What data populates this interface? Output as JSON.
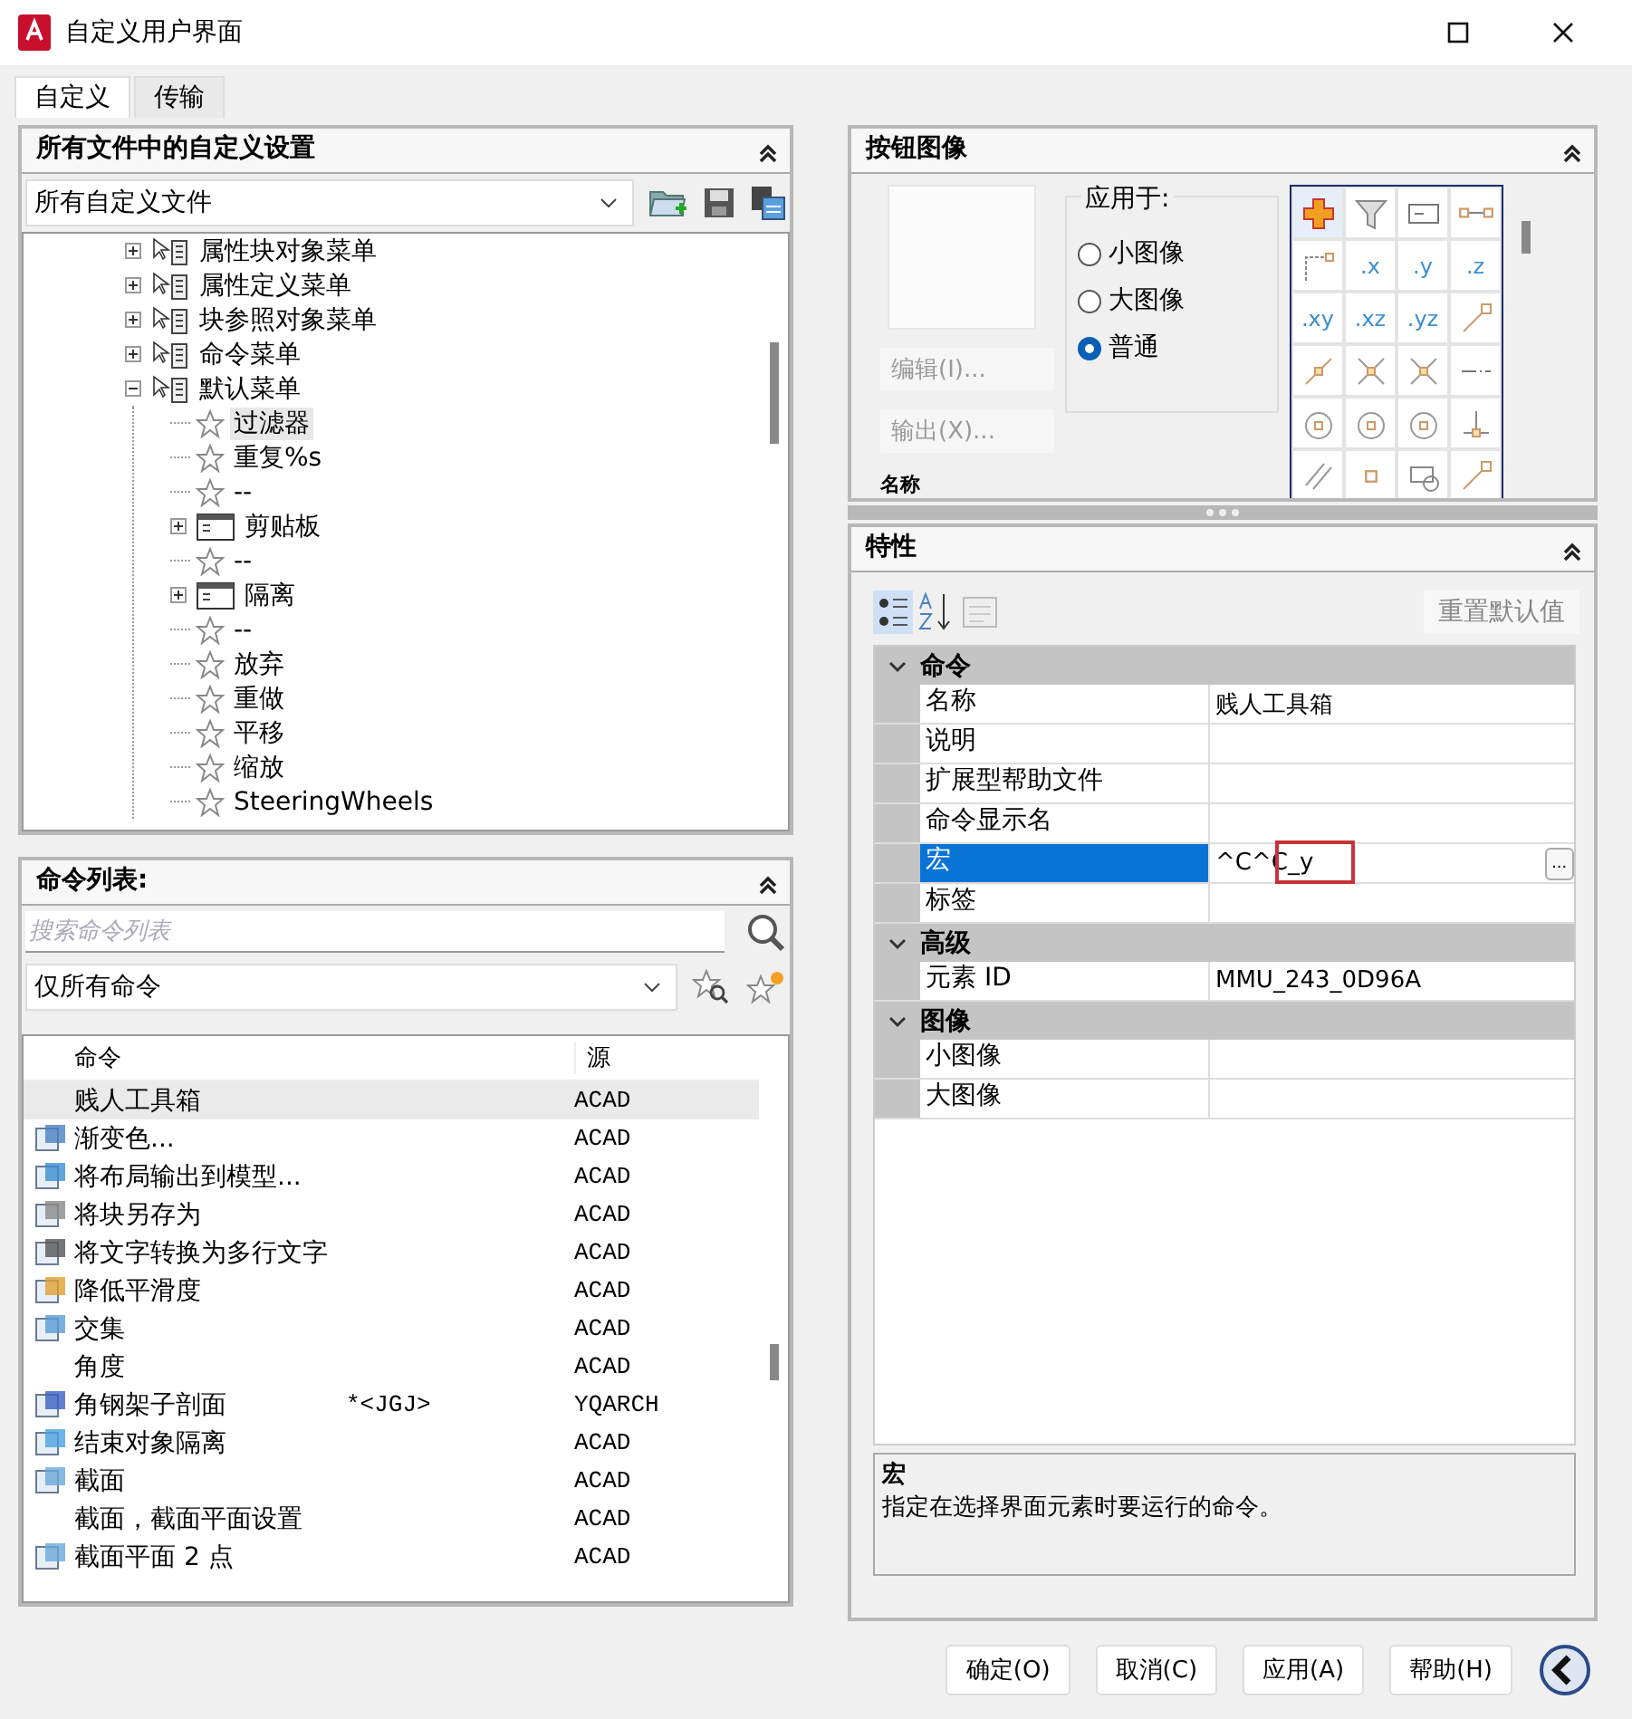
{
  "window": {
    "title": "自定义用户界面"
  },
  "tabs": [
    {
      "label": "自定义",
      "selected": true
    },
    {
      "label": "传输",
      "selected": false
    }
  ],
  "customizations": {
    "title": "所有文件中的自定义设置",
    "filter": "所有自定义文件",
    "tree": [
      {
        "label": "属性块对象菜单",
        "kind": "menu",
        "expanded": false,
        "selected": false
      },
      {
        "label": "属性定义菜单",
        "kind": "menu",
        "expanded": false,
        "selected": false
      },
      {
        "label": "块参照对象菜单",
        "kind": "menu",
        "expanded": false,
        "selected": false
      },
      {
        "label": "命令菜单",
        "kind": "menu",
        "expanded": false,
        "selected": false
      },
      {
        "label": "默认菜单",
        "kind": "menu",
        "expanded": true,
        "selected": false,
        "children": [
          {
            "label": "过滤器",
            "kind": "command",
            "selected": true
          },
          {
            "label": "重复%s",
            "kind": "command",
            "selected": false
          },
          {
            "label": "--",
            "kind": "command",
            "selected": false
          },
          {
            "label": "剪贴板",
            "kind": "submenu",
            "expanded": false,
            "selected": false
          },
          {
            "label": "--",
            "kind": "command",
            "selected": false
          },
          {
            "label": "隔离",
            "kind": "submenu",
            "expanded": false,
            "selected": false
          },
          {
            "label": "--",
            "kind": "command",
            "selected": false
          },
          {
            "label": "放弃",
            "kind": "command",
            "selected": false
          },
          {
            "label": "重做",
            "kind": "command",
            "selected": false
          },
          {
            "label": "平移",
            "kind": "command",
            "selected": false
          },
          {
            "label": "缩放",
            "kind": "command",
            "selected": false
          },
          {
            "label": "SteeringWheels",
            "kind": "command",
            "selected": false
          }
        ]
      }
    ]
  },
  "command_list": {
    "title": "命令列表:",
    "search": {
      "placeholder": "搜索命令列表"
    },
    "filter": "仅所有命令",
    "columns": [
      "命令",
      "源"
    ],
    "rows": [
      {
        "command": "贱人工具箱",
        "source": "ACAD",
        "icon": false,
        "selected": true
      },
      {
        "command": "渐变色...",
        "source": "ACAD",
        "icon": true,
        "selected": false
      },
      {
        "command": "将布局输出到模型...",
        "source": "ACAD",
        "icon": true,
        "selected": false
      },
      {
        "command": "将块另存为",
        "source": "ACAD",
        "icon": true,
        "selected": false
      },
      {
        "command": "将文字转换为多行文字",
        "source": "ACAD",
        "icon": true,
        "selected": false
      },
      {
        "command": "降低平滑度",
        "source": "ACAD",
        "icon": true,
        "selected": false
      },
      {
        "command": "交集",
        "source": "ACAD",
        "icon": true,
        "selected": false
      },
      {
        "command": "角度",
        "source": "ACAD",
        "icon": false,
        "selected": false
      },
      {
        "command": "角钢架子剖面",
        "alias": "*<JGJ>",
        "source": "YQARCH",
        "icon": true,
        "selected": false
      },
      {
        "command": "结束对象隔离",
        "source": "ACAD",
        "icon": true,
        "selected": false
      },
      {
        "command": "截面",
        "source": "ACAD",
        "icon": true,
        "selected": false
      },
      {
        "command": "截面，截面平面设置",
        "source": "ACAD",
        "icon": false,
        "selected": false
      },
      {
        "command": "截面平面 2 点",
        "source": "ACAD",
        "icon": true,
        "selected": false
      }
    ]
  },
  "button_image": {
    "title": "按钮图像",
    "buttons": [
      {
        "label": "编辑(I)...",
        "disabled": true
      },
      {
        "label": "输出(X)...",
        "disabled": true
      }
    ],
    "apply_to": {
      "legend": "应用于:",
      "options": [
        {
          "label": "小图像",
          "selected": false
        },
        {
          "label": "大图像",
          "selected": false
        },
        {
          "label": "普通",
          "selected": true
        }
      ]
    },
    "images": [
      {
        "kind": "icon",
        "selected": true
      },
      {
        "kind": "icon",
        "selected": false
      },
      {
        "kind": "icon",
        "selected": false
      },
      {
        "kind": "icon",
        "selected": false
      },
      {
        "kind": "icon",
        "selected": false
      },
      {
        "kind": "label",
        "text": ".x",
        "selected": false
      },
      {
        "kind": "label",
        "text": ".y",
        "selected": false
      },
      {
        "kind": "label",
        "text": ".z",
        "selected": false
      },
      {
        "kind": "label",
        "text": ".xy",
        "selected": false
      },
      {
        "kind": "label",
        "text": ".xz",
        "selected": false
      },
      {
        "kind": "label",
        "text": ".yz",
        "selected": false
      },
      {
        "kind": "icon",
        "selected": false
      },
      {
        "kind": "icon",
        "selected": false
      },
      {
        "kind": "icon",
        "selected": false
      },
      {
        "kind": "icon",
        "selected": false
      },
      {
        "kind": "icon",
        "selected": false
      },
      {
        "kind": "icon",
        "selected": false
      },
      {
        "kind": "icon",
        "selected": false
      },
      {
        "kind": "icon",
        "selected": false
      },
      {
        "kind": "icon",
        "selected": false
      },
      {
        "kind": "icon",
        "selected": false
      },
      {
        "kind": "icon",
        "selected": false
      },
      {
        "kind": "icon",
        "selected": false
      },
      {
        "kind": "icon",
        "selected": false
      }
    ],
    "name_label": "名称"
  },
  "properties": {
    "title": "特性",
    "reset_button": {
      "label": "重置默认值",
      "disabled": true
    },
    "categories": [
      {
        "name": "命令",
        "expanded": true,
        "rows": [
          {
            "name": "名称",
            "value": "贱人工具箱",
            "selected": false,
            "marked": false
          },
          {
            "name": "说明",
            "selected": false,
            "marked": false
          },
          {
            "name": "扩展型帮助文件",
            "selected": false,
            "marked": false
          },
          {
            "name": "命令显示名",
            "selected": false,
            "marked": false
          },
          {
            "name": "宏",
            "value": "^C^C_y",
            "selected": true,
            "button": "...",
            "marked": true
          },
          {
            "name": "标签",
            "selected": false,
            "marked": false
          }
        ]
      },
      {
        "name": "高级",
        "expanded": true,
        "rows": [
          {
            "name": "元素 ID",
            "value": "MMU_243_0D96A",
            "selected": false,
            "marked": false
          }
        ]
      },
      {
        "name": "图像",
        "expanded": true,
        "rows": [
          {
            "name": "小图像",
            "selected": false,
            "marked": false
          },
          {
            "name": "大图像",
            "selected": false,
            "marked": false
          }
        ]
      }
    ],
    "description": {
      "title": "宏",
      "text": "指定在选择界面元素时要运行的命令。"
    }
  },
  "footer_buttons": [
    "确定(O)",
    "取消(C)",
    "应用(A)",
    "帮助(H)"
  ]
}
